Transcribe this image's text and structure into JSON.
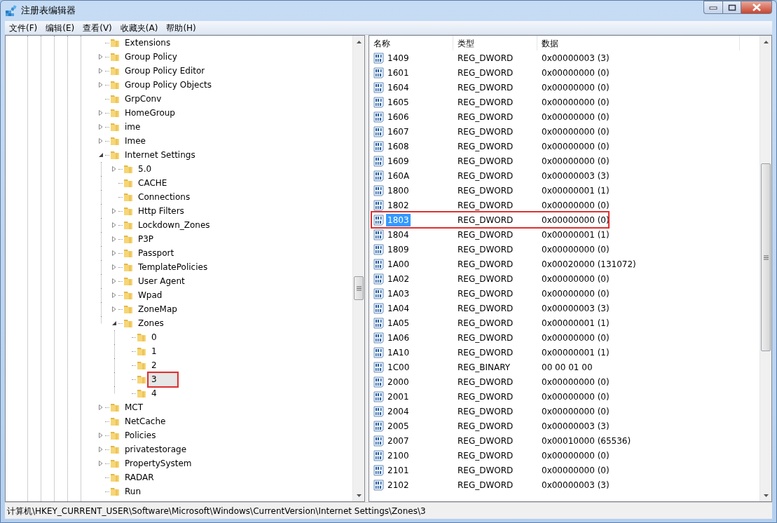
{
  "window": {
    "title": "注册表编辑器"
  },
  "menu": [
    "文件(F)",
    "编辑(E)",
    "查看(V)",
    "收藏夹(A)",
    "帮助(H)"
  ],
  "tree": [
    {
      "label": "Extensions",
      "selected": false
    },
    {
      "label": "Group Policy",
      "expanded": false,
      "selected": false
    },
    {
      "label": "Group Policy Editor",
      "expanded": false,
      "selected": false
    },
    {
      "label": "Group Policy Objects",
      "expanded": false,
      "selected": false
    },
    {
      "label": "GrpConv",
      "selected": false
    },
    {
      "label": "HomeGroup",
      "expanded": false,
      "selected": false
    },
    {
      "label": "ime",
      "expanded": false,
      "selected": false
    },
    {
      "label": "Imee",
      "expanded": false,
      "selected": false
    },
    {
      "label": "Internet Settings",
      "expanded": true,
      "selected": false,
      "children": [
        {
          "label": "5.0",
          "expanded": false,
          "selected": false
        },
        {
          "label": "CACHE",
          "selected": false
        },
        {
          "label": "Connections",
          "selected": false
        },
        {
          "label": "Http Filters",
          "expanded": false,
          "selected": false
        },
        {
          "label": "Lockdown_Zones",
          "expanded": false,
          "selected": false
        },
        {
          "label": "P3P",
          "expanded": false,
          "selected": false
        },
        {
          "label": "Passport",
          "expanded": false,
          "selected": false
        },
        {
          "label": "TemplatePolicies",
          "expanded": false,
          "selected": false
        },
        {
          "label": "User Agent",
          "expanded": false,
          "selected": false
        },
        {
          "label": "Wpad",
          "expanded": false,
          "selected": false
        },
        {
          "label": "ZoneMap",
          "expanded": false,
          "selected": false
        },
        {
          "label": "Zones",
          "expanded": true,
          "selected": false,
          "children": [
            {
              "label": "0",
              "selected": false
            },
            {
              "label": "1",
              "selected": false
            },
            {
              "label": "2",
              "selected": false
            },
            {
              "label": "3",
              "selected": true,
              "highlighted": true
            },
            {
              "label": "4",
              "selected": false
            }
          ]
        }
      ]
    },
    {
      "label": "MCT",
      "expanded": false,
      "selected": false
    },
    {
      "label": "NetCache",
      "selected": false
    },
    {
      "label": "Policies",
      "expanded": false,
      "selected": false
    },
    {
      "label": "privatestorage",
      "expanded": false,
      "selected": false
    },
    {
      "label": "PropertySystem",
      "expanded": false,
      "selected": false
    },
    {
      "label": "RADAR",
      "selected": false
    },
    {
      "label": "Run",
      "selected": false
    }
  ],
  "table": {
    "columns": [
      "名称",
      "类型",
      "数据"
    ],
    "rows": [
      {
        "name": "1409",
        "type": "REG_DWORD",
        "data": "0x00000003 (3)",
        "selected": false
      },
      {
        "name": "1601",
        "type": "REG_DWORD",
        "data": "0x00000000 (0)",
        "selected": false
      },
      {
        "name": "1604",
        "type": "REG_DWORD",
        "data": "0x00000000 (0)",
        "selected": false
      },
      {
        "name": "1605",
        "type": "REG_DWORD",
        "data": "0x00000000 (0)",
        "selected": false
      },
      {
        "name": "1606",
        "type": "REG_DWORD",
        "data": "0x00000000 (0)",
        "selected": false
      },
      {
        "name": "1607",
        "type": "REG_DWORD",
        "data": "0x00000000 (0)",
        "selected": false
      },
      {
        "name": "1608",
        "type": "REG_DWORD",
        "data": "0x00000000 (0)",
        "selected": false
      },
      {
        "name": "1609",
        "type": "REG_DWORD",
        "data": "0x00000000 (0)",
        "selected": false
      },
      {
        "name": "160A",
        "type": "REG_DWORD",
        "data": "0x00000003 (3)",
        "selected": false
      },
      {
        "name": "1800",
        "type": "REG_DWORD",
        "data": "0x00000001 (1)",
        "selected": false
      },
      {
        "name": "1802",
        "type": "REG_DWORD",
        "data": "0x00000000 (0)",
        "selected": false
      },
      {
        "name": "1803",
        "type": "REG_DWORD",
        "data": "0x00000000 (0)",
        "selected": true,
        "highlighted": true
      },
      {
        "name": "1804",
        "type": "REG_DWORD",
        "data": "0x00000001 (1)",
        "selected": false
      },
      {
        "name": "1809",
        "type": "REG_DWORD",
        "data": "0x00000000 (0)",
        "selected": false
      },
      {
        "name": "1A00",
        "type": "REG_DWORD",
        "data": "0x00020000 (131072)",
        "selected": false
      },
      {
        "name": "1A02",
        "type": "REG_DWORD",
        "data": "0x00000000 (0)",
        "selected": false
      },
      {
        "name": "1A03",
        "type": "REG_DWORD",
        "data": "0x00000000 (0)",
        "selected": false
      },
      {
        "name": "1A04",
        "type": "REG_DWORD",
        "data": "0x00000003 (3)",
        "selected": false
      },
      {
        "name": "1A05",
        "type": "REG_DWORD",
        "data": "0x00000001 (1)",
        "selected": false
      },
      {
        "name": "1A06",
        "type": "REG_DWORD",
        "data": "0x00000000 (0)",
        "selected": false
      },
      {
        "name": "1A10",
        "type": "REG_DWORD",
        "data": "0x00000001 (1)",
        "selected": false
      },
      {
        "name": "1C00",
        "type": "REG_BINARY",
        "data": "00 00 01 00",
        "selected": false
      },
      {
        "name": "2000",
        "type": "REG_DWORD",
        "data": "0x00000000 (0)",
        "selected": false
      },
      {
        "name": "2001",
        "type": "REG_DWORD",
        "data": "0x00000000 (0)",
        "selected": false
      },
      {
        "name": "2004",
        "type": "REG_DWORD",
        "data": "0x00000000 (0)",
        "selected": false
      },
      {
        "name": "2005",
        "type": "REG_DWORD",
        "data": "0x00000003 (3)",
        "selected": false
      },
      {
        "name": "2007",
        "type": "REG_DWORD",
        "data": "0x00010000 (65536)",
        "selected": false
      },
      {
        "name": "2100",
        "type": "REG_DWORD",
        "data": "0x00000000 (0)",
        "selected": false
      },
      {
        "name": "2101",
        "type": "REG_DWORD",
        "data": "0x00000000 (0)",
        "selected": false
      },
      {
        "name": "2102",
        "type": "REG_DWORD",
        "data": "0x00000003 (3)",
        "selected": false
      }
    ]
  },
  "status_bar": "计算机\\HKEY_CURRENT_USER\\Software\\Microsoft\\Windows\\CurrentVersion\\Internet Settings\\Zones\\3"
}
